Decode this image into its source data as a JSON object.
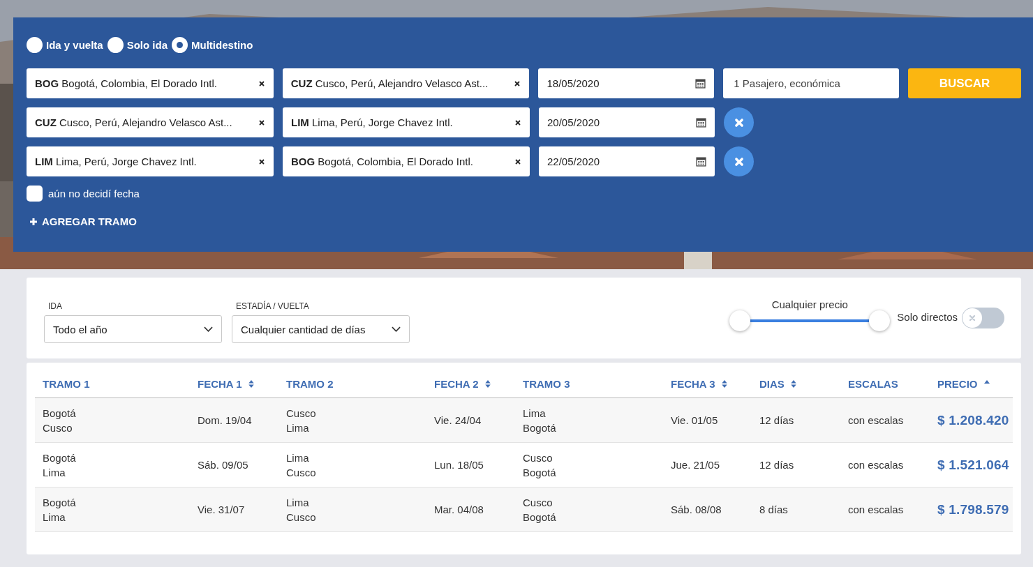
{
  "trip_types": [
    {
      "label": "Ida y vuelta",
      "selected": false
    },
    {
      "label": "Solo ida",
      "selected": false
    },
    {
      "label": "Multidestino",
      "selected": true
    }
  ],
  "legs": [
    {
      "origin": {
        "code": "BOG",
        "name": "Bogotá, Colombia, El Dorado Intl."
      },
      "destination": {
        "code": "CUZ",
        "name": "Cusco, Perú, Alejandro Velasco Ast..."
      },
      "date": "18/05/2020",
      "removable": false
    },
    {
      "origin": {
        "code": "CUZ",
        "name": "Cusco, Perú, Alejandro Velasco Ast..."
      },
      "destination": {
        "code": "LIM",
        "name": "Lima, Perú, Jorge Chavez Intl."
      },
      "date": "20/05/2020",
      "removable": true
    },
    {
      "origin": {
        "code": "LIM",
        "name": "Lima, Perú, Jorge Chavez Intl."
      },
      "destination": {
        "code": "BOG",
        "name": "Bogotá, Colombia, El Dorado Intl."
      },
      "date": "22/05/2020",
      "removable": true
    }
  ],
  "passengers": "1 Pasajero, económica",
  "search_button": "BUSCAR",
  "undecided_date": {
    "label": "aún no decidí fecha",
    "checked": false
  },
  "add_leg": "AGREGAR TRAMO",
  "filters": {
    "departure": {
      "label": "IDA",
      "value": "Todo el año"
    },
    "stay": {
      "label": "ESTADÍA / VUELTA",
      "value": "Cualquier cantidad de días"
    },
    "price": {
      "label": "Cualquier precio",
      "thumbs": [
        {
          "level": 0
        },
        {
          "level": 1
        }
      ]
    },
    "direct_only": {
      "label": "Solo directos",
      "on": false
    }
  },
  "table": {
    "columns": [
      {
        "label": "TRAMO 1",
        "sortable": false,
        "sorted": false
      },
      {
        "label": "FECHA 1",
        "sortable": true,
        "sorted": false
      },
      {
        "label": "TRAMO 2",
        "sortable": false,
        "sorted": false
      },
      {
        "label": "FECHA 2",
        "sortable": true,
        "sorted": false
      },
      {
        "label": "TRAMO 3",
        "sortable": false,
        "sorted": false
      },
      {
        "label": "FECHA 3",
        "sortable": true,
        "sorted": false
      },
      {
        "label": "DIAS",
        "sortable": true,
        "sorted": false
      },
      {
        "label": "ESCALAS",
        "sortable": false,
        "sorted": false
      },
      {
        "label": "PRECIO",
        "sortable": false,
        "sorted": true
      }
    ],
    "rows": [
      {
        "segments": [
          {
            "from": "Bogotá",
            "to": "Cusco",
            "date": "Dom. 19/04"
          },
          {
            "from": "Cusco",
            "to": "Lima",
            "date": "Vie. 24/04"
          },
          {
            "from": "Lima",
            "to": "Bogotá",
            "date": "Vie. 01/05"
          }
        ],
        "days": "12 días",
        "stops": "con escalas",
        "price": "$ 1.208.420"
      },
      {
        "segments": [
          {
            "from": "Bogotá",
            "to": "Lima",
            "date": "Sáb. 09/05"
          },
          {
            "from": "Lima",
            "to": "Cusco",
            "date": "Lun. 18/05"
          },
          {
            "from": "Cusco",
            "to": "Bogotá",
            "date": "Jue. 21/05"
          }
        ],
        "days": "12 días",
        "stops": "con escalas",
        "price": "$ 1.521.064"
      },
      {
        "segments": [
          {
            "from": "Bogotá",
            "to": "Lima",
            "date": "Vie. 31/07"
          },
          {
            "from": "Lima",
            "to": "Cusco",
            "date": "Mar. 04/08"
          },
          {
            "from": "Cusco",
            "to": "Bogotá",
            "date": "Sáb. 08/08"
          }
        ],
        "days": "8 días",
        "stops": "con escalas",
        "price": "$ 1.798.579"
      }
    ]
  }
}
